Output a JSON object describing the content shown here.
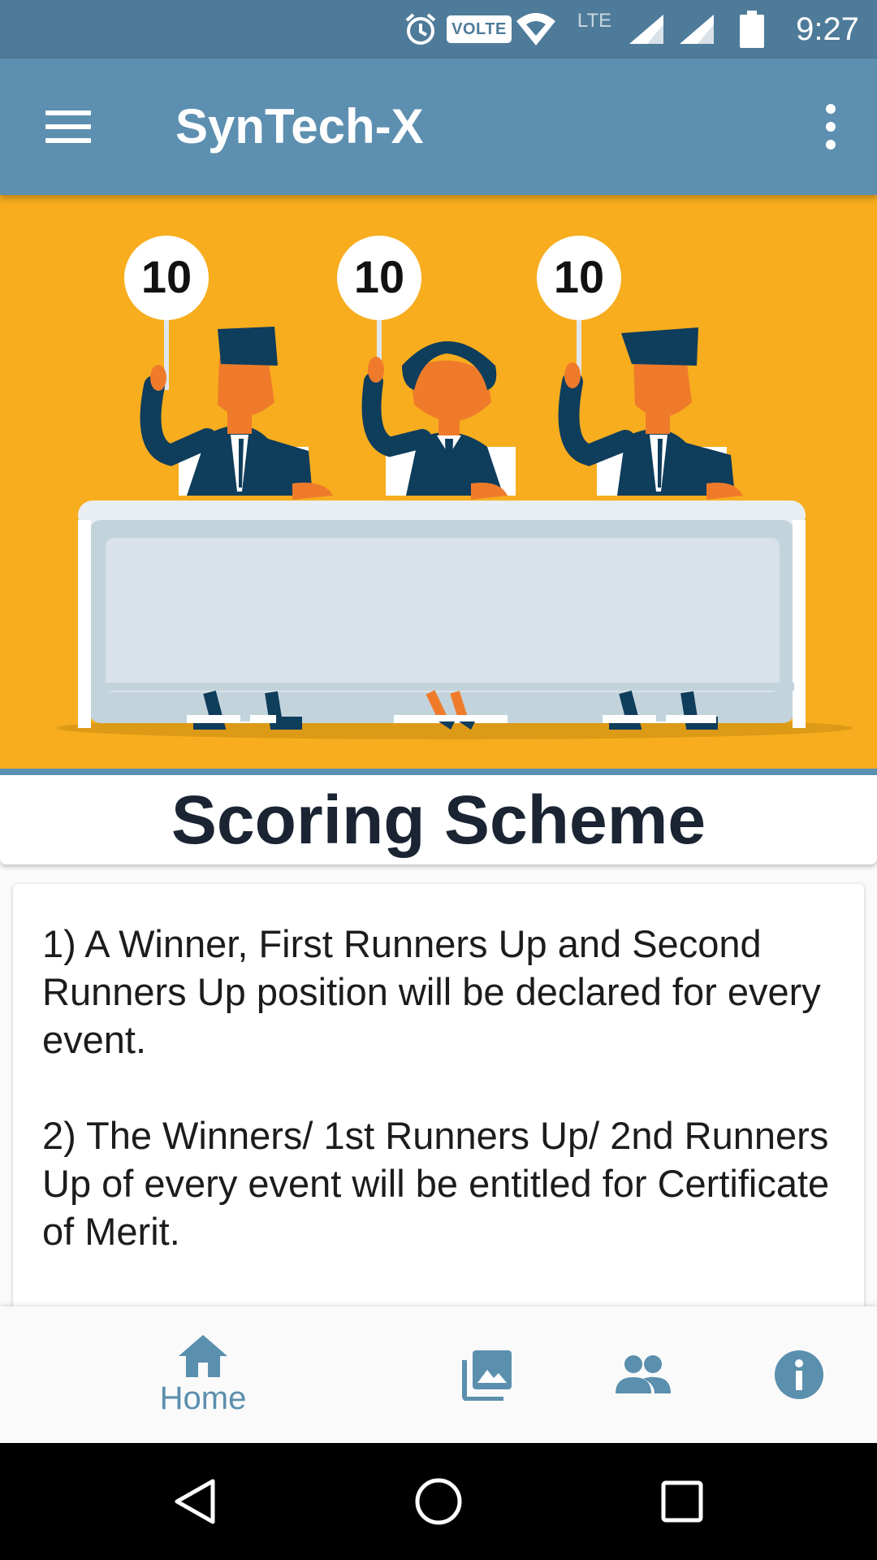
{
  "status_bar": {
    "time": "9:27",
    "volte": "VOLTE",
    "network": "LTE",
    "icons": [
      "alarm-icon",
      "volte-icon",
      "wifi-icon",
      "signal-icon",
      "signal-icon",
      "battery-icon"
    ]
  },
  "app_bar": {
    "title": "SynTech-X",
    "icons": [
      "menu-icon",
      "more-vert-icon"
    ]
  },
  "hero": {
    "score_cards": [
      "10",
      "10",
      "10"
    ],
    "colors": {
      "background": "#f7ad1e",
      "skin": "#ef7b2a",
      "suit": "#0f3d5c"
    }
  },
  "main": {
    "heading": "Scoring Scheme",
    "rules": [
      "1) A Winner, First Runners Up and Second Runners Up position will be declared for every event.",
      "2) The Winners/ 1st Runners Up/ 2nd Runners Up of every event will be entitled for Certificate of Merit."
    ]
  },
  "bottom_nav": {
    "home_label": "Home",
    "items": [
      "home-icon",
      "gallery-icon",
      "people-icon",
      "info-icon"
    ],
    "accent": "#5b8fae"
  },
  "system_nav": {
    "icons": [
      "back-icon",
      "home-circle-icon",
      "recents-icon"
    ]
  }
}
